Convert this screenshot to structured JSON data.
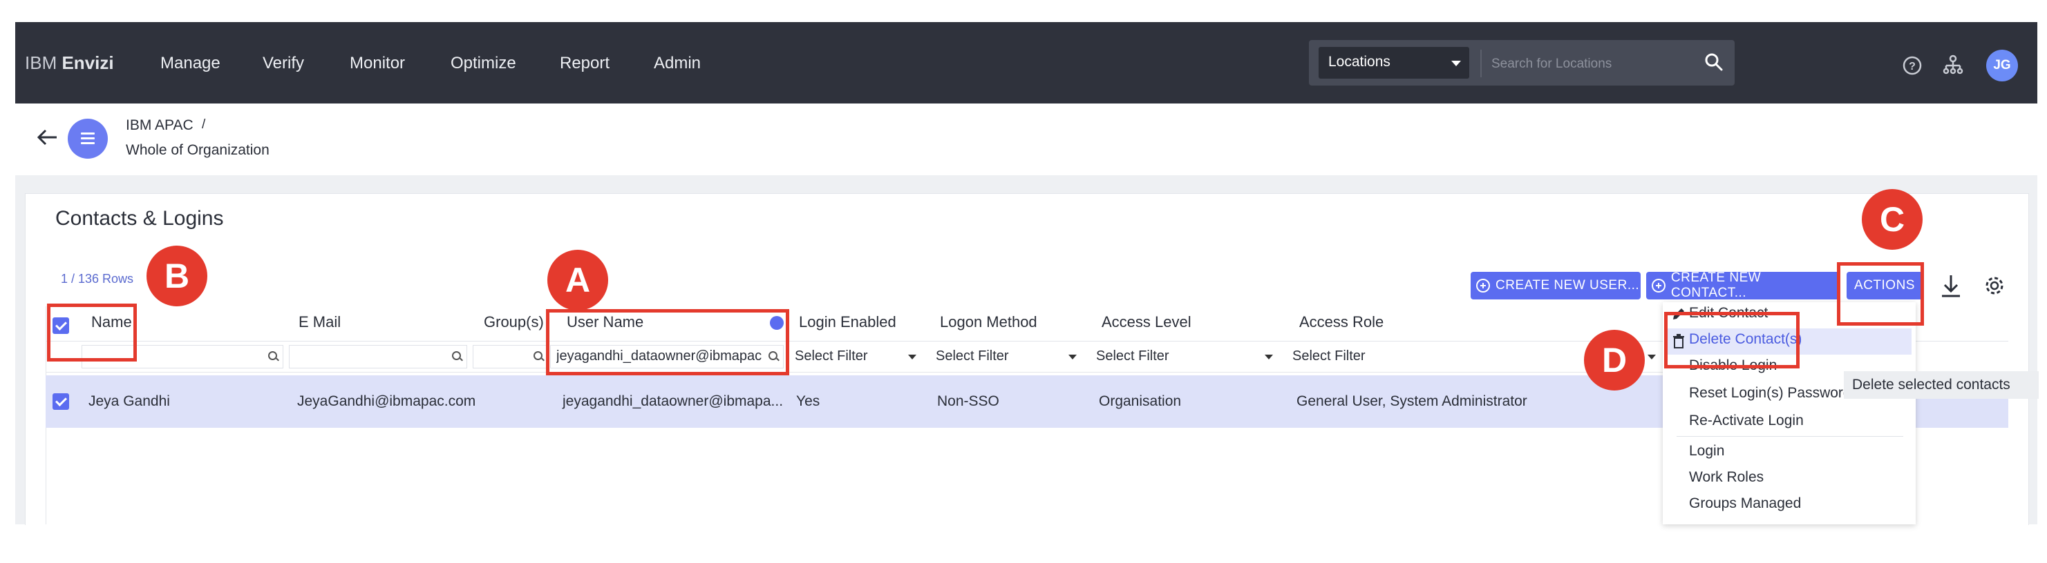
{
  "header": {
    "brand_prefix": "IBM",
    "brand_name": "Envizi",
    "nav": [
      "Manage",
      "Verify",
      "Monitor",
      "Optimize",
      "Report",
      "Admin"
    ],
    "location_select": "Locations",
    "search_placeholder": "Search for Locations",
    "avatar_initials": "JG"
  },
  "breadcrumb": {
    "parent": "IBM APAC",
    "separator": "/",
    "current": "Whole of Organization"
  },
  "panel": {
    "title": "Contacts & Logins",
    "row_count": "1 / 136 Rows",
    "buttons": {
      "create_user": "CREATE NEW USER...",
      "create_contact": "CREATE NEW CONTACT...",
      "actions": "ACTIONS"
    }
  },
  "table": {
    "columns": [
      "Name",
      "E Mail",
      "Group(s) N",
      "User Name",
      "Login Enabled",
      "Logon Method",
      "Access Level",
      "Access Role"
    ],
    "filters": {
      "username_value": "jeyagandhi_dataowner@ibmapac",
      "select_placeholder": "Select Filter"
    },
    "rows": [
      {
        "name": "Jeya Gandhi",
        "email": "JeyaGandhi@ibmapac.com",
        "username": "jeyagandhi_dataowner@ibmapa...",
        "login_enabled": "Yes",
        "logon_method": "Non-SSO",
        "access_level": "Organisation",
        "access_role": "General User, System Administrator"
      }
    ]
  },
  "actions_menu": {
    "items": [
      "Edit Contact",
      "Delete Contact(s)",
      "Disable Login",
      "Reset Login(s) Password",
      "Re-Activate Login",
      "Login",
      "Work Roles",
      "Groups Managed"
    ],
    "tooltip": "Delete selected contacts"
  },
  "annotations": [
    "A",
    "B",
    "C",
    "D"
  ],
  "colors": {
    "topbar": "#2f323c",
    "accent": "#5b6cf0",
    "annotation_red": "#e43a2d",
    "selected_row": "#dde1f9"
  }
}
